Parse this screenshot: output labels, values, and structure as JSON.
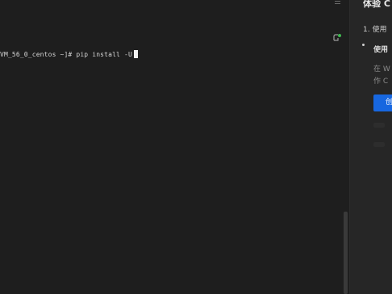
{
  "terminal": {
    "prompt": "VM_56_0_centos ~]# ",
    "command": "pip install -U"
  },
  "panel": {
    "title": "体验 C",
    "step": "1. 使用",
    "subtitle": "使用",
    "desc_line1": "在 W",
    "desc_line2": "作 C",
    "button_label": "创"
  },
  "colors": {
    "terminal_bg": "#1e1e1e",
    "panel_bg": "#262626",
    "accent": "#1767e0",
    "status_icon": "#3fb950"
  },
  "icons": {
    "terminal_menu": "menu-icon",
    "terminal_status": "connection-status-icon"
  }
}
